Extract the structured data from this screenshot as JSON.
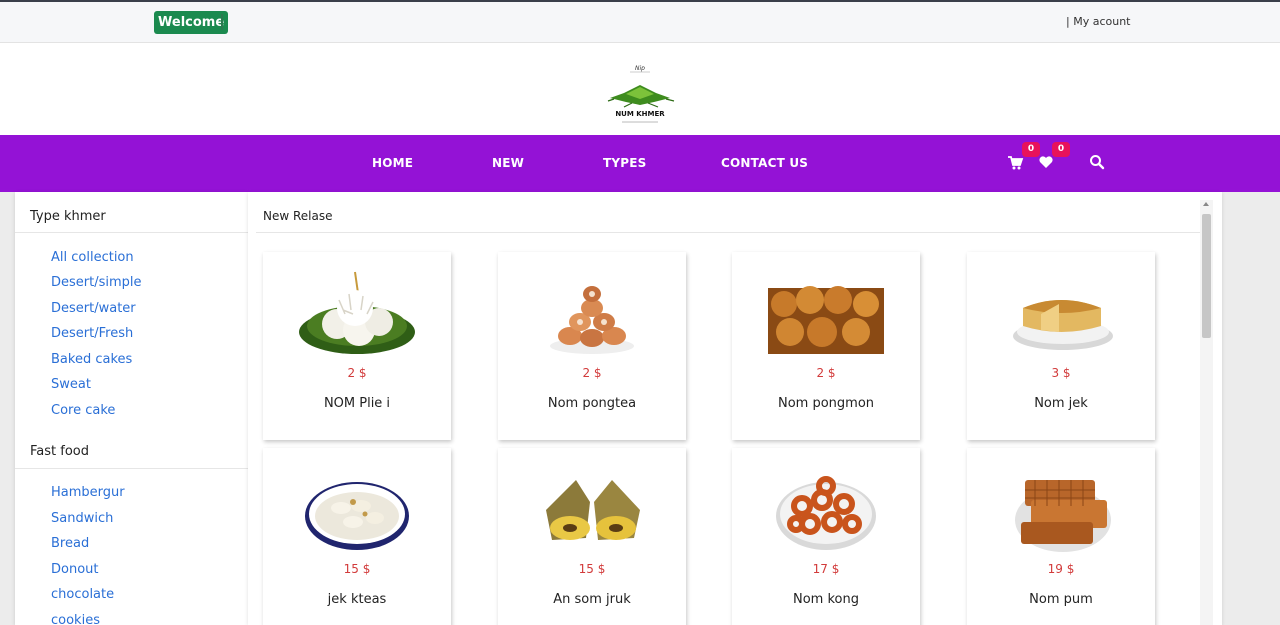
{
  "topbar": {
    "welcome_label": "Welcome",
    "account_label": "| My acount"
  },
  "logo": {
    "text": "NUM KHMER"
  },
  "nav": {
    "items": [
      {
        "label": "HOME"
      },
      {
        "label": "NEW"
      },
      {
        "label": "TYPES"
      },
      {
        "label": "CONTACT US"
      }
    ],
    "cart_count": "0",
    "wishlist_count": "0",
    "icons": [
      "cart-icon",
      "heart-icon",
      "search-icon"
    ]
  },
  "sidebar": {
    "sections": [
      {
        "heading": "Type khmer",
        "links": [
          "All collection",
          "Desert/simple",
          "Desert/water",
          "Desert/Fresh",
          "Baked cakes",
          "Sweat",
          "Core cake"
        ]
      },
      {
        "heading": "Fast food",
        "links": [
          "Hambergur",
          "Sandwich",
          "Bread",
          "Donout",
          "chocolate",
          "cookies"
        ]
      }
    ]
  },
  "main": {
    "heading": "New Relase",
    "products": [
      {
        "name": "NOM Plie i",
        "price": "2 $",
        "icon": "coconut-dessert-image"
      },
      {
        "name": "Nom pongtea",
        "price": "2 $",
        "icon": "stacked-cakes-image"
      },
      {
        "name": "Nom pongmon",
        "price": "2 $",
        "icon": "muffins-image"
      },
      {
        "name": "Nom jek",
        "price": "3 $",
        "icon": "sponge-cake-image"
      },
      {
        "name": "jek kteas",
        "price": "15 $",
        "icon": "banana-coconut-bowl-image"
      },
      {
        "name": "An som jruk",
        "price": "15 $",
        "icon": "leaf-wrapped-rice-cake-image"
      },
      {
        "name": "Nom kong",
        "price": "17 $",
        "icon": "ring-donuts-image"
      },
      {
        "name": "Nom pum",
        "price": "19 $",
        "icon": "waffle-cake-image"
      }
    ]
  },
  "colors": {
    "nav": "#9412d6",
    "welcome": "#1b8a4f",
    "badge": "#e8125b",
    "link": "#2a6fd6",
    "price": "#d23b3b"
  }
}
